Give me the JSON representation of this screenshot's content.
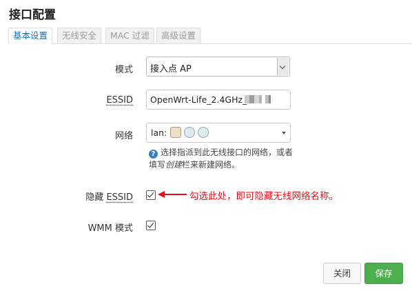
{
  "dialog": {
    "title": "接口配置"
  },
  "tabs": [
    {
      "label": "基本设置",
      "active": true
    },
    {
      "label": "无线安全",
      "active": false
    },
    {
      "label": "MAC 过滤",
      "active": false
    },
    {
      "label": "高级设置",
      "active": false
    }
  ],
  "form": {
    "mode": {
      "label": "模式",
      "value": "接入点 AP"
    },
    "essid": {
      "label": "ESSID",
      "value": "OpenWrt-Life_2.4GHz_"
    },
    "network": {
      "label": "网络",
      "value": "lan:",
      "help_prefix": "选择指派到此无线接口的网络，或者填写",
      "help_em": "创建",
      "help_suffix": "栏来新建网络。"
    },
    "hidden_essid": {
      "label_prefix": "隐藏",
      "label_suffix": "ESSID",
      "checked": true
    },
    "wmm": {
      "label": "WMM 模式",
      "checked": true
    }
  },
  "annotation": {
    "text": "勾选此处，即可隐藏无线网络名称。",
    "color": "#e0101a"
  },
  "buttons": {
    "close": "关闭",
    "save": "保存"
  },
  "colors": {
    "accent": "#1b6fa8",
    "save": "#4cae4c",
    "help_icon": "#3a7fc1"
  }
}
